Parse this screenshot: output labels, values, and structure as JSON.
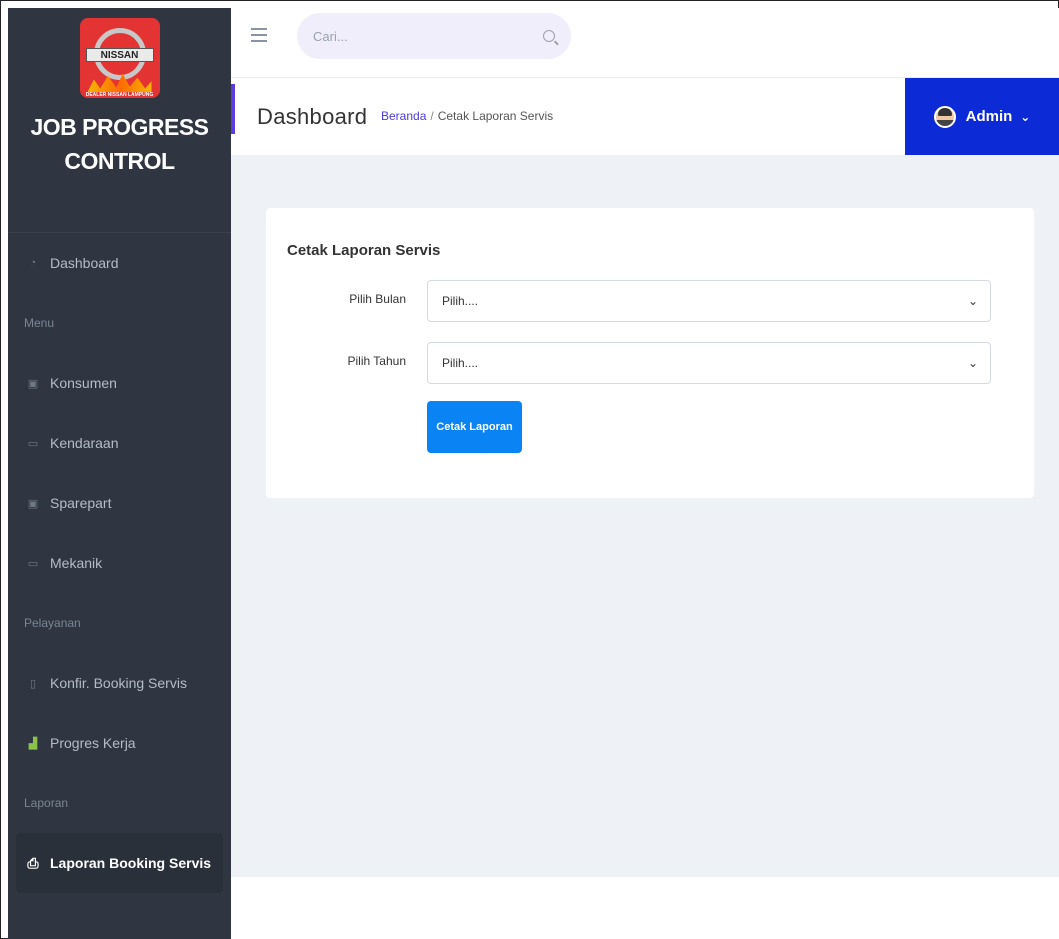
{
  "brand": {
    "logo_text": "NISSAN",
    "logo_tagline": "DEALER NISSAN LAMPUNG",
    "title_line1": "JOB PROGRESS",
    "title_line2": "CONTROL"
  },
  "sidebar": {
    "items": [
      {
        "type": "link",
        "label": "Dashboard",
        "icon": "dashboard-icon"
      },
      {
        "type": "section",
        "label": "Menu"
      },
      {
        "type": "link",
        "label": "Konsumen",
        "icon": "id-card-icon"
      },
      {
        "type": "link",
        "label": "Kendaraan",
        "icon": "vehicle-icon"
      },
      {
        "type": "link",
        "label": "Sparepart",
        "icon": "id-card-icon"
      },
      {
        "type": "link",
        "label": "Mekanik",
        "icon": "vehicle-icon"
      },
      {
        "type": "section",
        "label": "Pelayanan"
      },
      {
        "type": "link",
        "label": "Konfir. Booking Servis",
        "icon": "file-icon"
      },
      {
        "type": "link",
        "label": "Progres Kerja",
        "icon": "bar-chart-icon"
      },
      {
        "type": "section",
        "label": "Laporan"
      },
      {
        "type": "link",
        "label": "Laporan Booking Servis",
        "icon": "printer-icon",
        "active": true
      }
    ]
  },
  "topbar": {
    "search_placeholder": "Cari..."
  },
  "header": {
    "page_title": "Dashboard",
    "breadcrumb_home": "Beranda",
    "breadcrumb_separator": "/",
    "breadcrumb_current": "Cetak Laporan Servis",
    "user_name": "Admin"
  },
  "form": {
    "title": "Cetak Laporan Servis",
    "month_label": "Pilih Bulan",
    "month_value": "Pilih....",
    "year_label": "Pilih Tahun",
    "year_value": "Pilih....",
    "submit_label": "Cetak Laporan"
  },
  "colors": {
    "sidebar_bg": "#2f3641",
    "admin_bg": "#0c2ad6",
    "primary_button": "#0a84f5",
    "accent": "#5b3ce0"
  }
}
